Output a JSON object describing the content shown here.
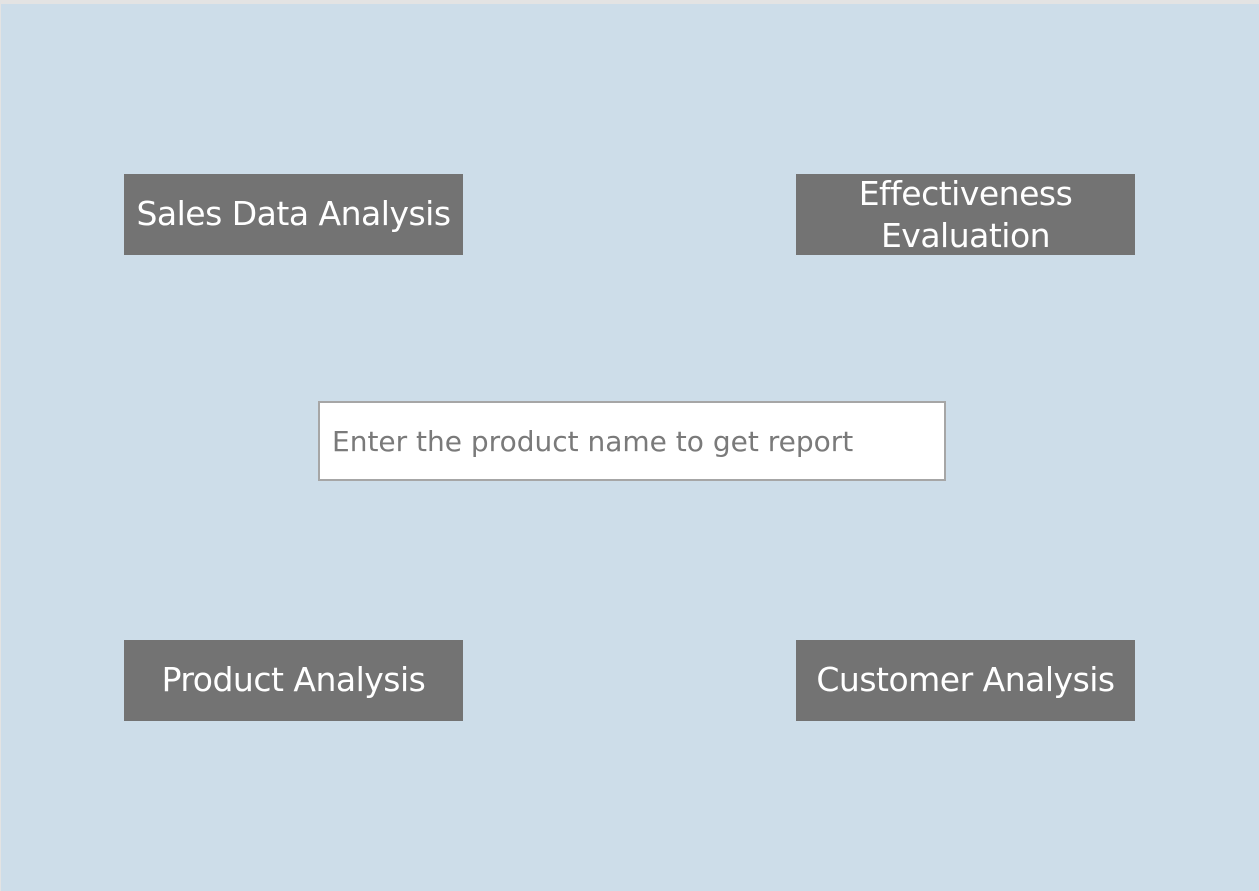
{
  "buttons": {
    "sales": "Sales Data Analysis",
    "effectiveness": "Effectiveness Evaluation",
    "product": "Product Analysis",
    "customer": "Customer Analysis"
  },
  "search": {
    "placeholder": "Enter the product name to get report",
    "value": ""
  },
  "colors": {
    "background": "#cddde9",
    "button_fill": "#737373",
    "button_text": "#ffffff",
    "input_border": "#a6a6a6"
  }
}
